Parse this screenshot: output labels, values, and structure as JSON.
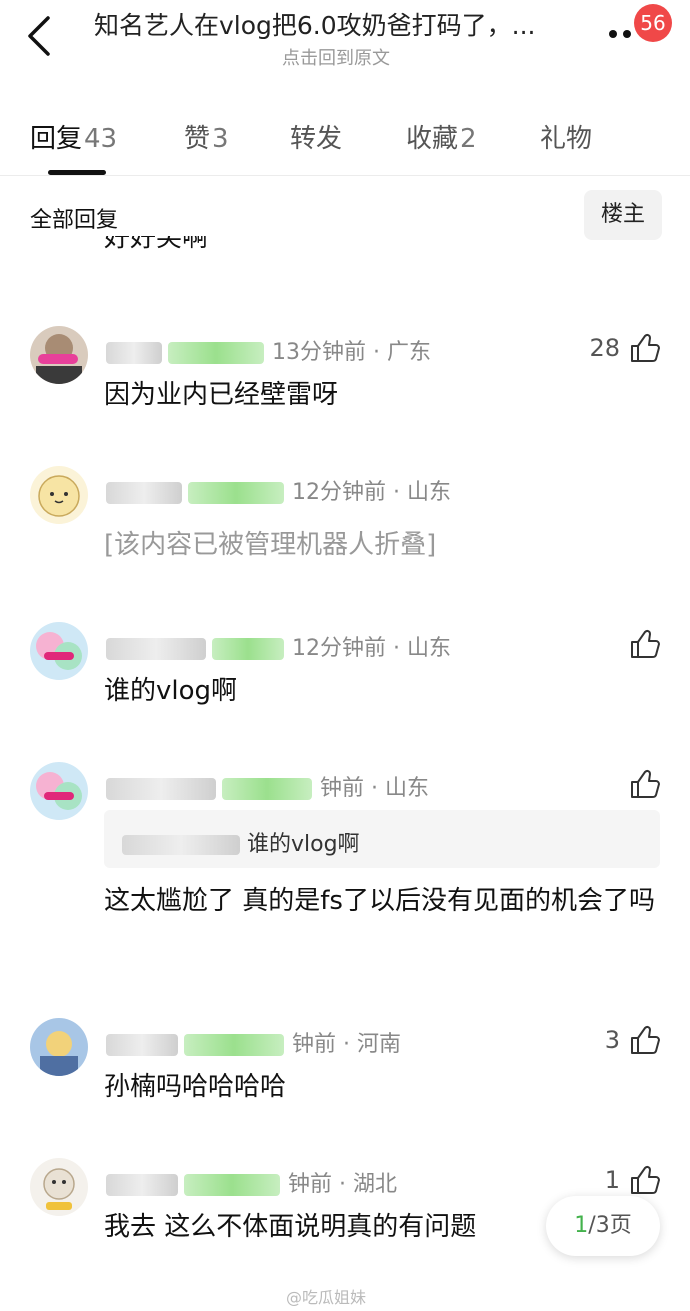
{
  "header": {
    "title": "知名艺人在vlog把6.0攻奶爸打码了，...",
    "subtitle": "点击回到原文",
    "badge_count": "56"
  },
  "tabs": [
    {
      "label": "回复",
      "count": "43",
      "active": true
    },
    {
      "label": "赞",
      "count": "3",
      "active": false
    },
    {
      "label": "转发",
      "count": "",
      "active": false
    },
    {
      "label": "收藏",
      "count": "2",
      "active": false
    },
    {
      "label": "礼物",
      "count": "",
      "active": false
    }
  ],
  "filter": {
    "label": "全部回复",
    "op_button": "楼主"
  },
  "partial_previous_text": "好好笑啊",
  "comments": [
    {
      "meta": "13分钟前 · 广东",
      "likes": "28",
      "text": "因为业内已经壁雷呀",
      "avatar_color": "#cbb7a6"
    },
    {
      "meta": "12分钟前 · 山东",
      "likes": "",
      "text": "[该内容已被管理机器人折叠]",
      "avatar_color": "#f6e7b5"
    },
    {
      "meta": "12分钟前 · 山东",
      "likes": "",
      "text": "谁的vlog啊",
      "avatar_color": "#e8a6c8"
    },
    {
      "meta": "钟前 · 山东",
      "likes": "",
      "quote": "谁的vlog啊",
      "text": "这太尴尬了 真的是fs了以后没有见面的机会了吗",
      "avatar_color": "#e8a6c8"
    },
    {
      "meta": "钟前 · 河南",
      "likes": "3",
      "text": "孙楠吗哈哈哈哈",
      "avatar_color": "#7d9cc4"
    },
    {
      "meta": "钟前 · 湖北",
      "likes": "1",
      "text": "我去  这么不体面说明真的有问题",
      "avatar_color": "#e7e0d6"
    }
  ],
  "pager": {
    "current": "1",
    "total": "/3页"
  },
  "watermark": "@吃瓜姐妹"
}
